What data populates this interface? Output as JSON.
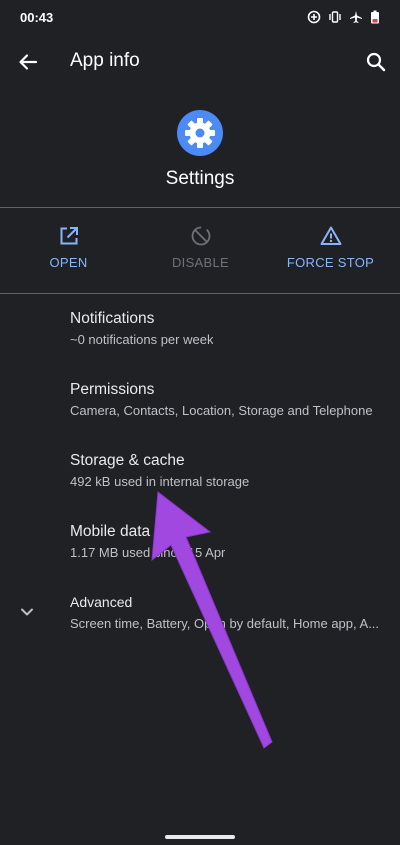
{
  "status_bar": {
    "time": "00:43",
    "icons": [
      "data-saver-icon",
      "vibrate-icon",
      "airplane-icon",
      "battery-low-icon"
    ]
  },
  "app_bar": {
    "title": "App info",
    "back_icon": "arrow-back-icon",
    "search_icon": "search-icon"
  },
  "app": {
    "name": "Settings",
    "icon": "gear-icon",
    "icon_color": "#4c8bf5"
  },
  "actions": [
    {
      "label": "OPEN",
      "icon": "open-external-icon",
      "enabled": true
    },
    {
      "label": "DISABLE",
      "icon": "disable-icon",
      "enabled": false
    },
    {
      "label": "FORCE STOP",
      "icon": "warning-icon",
      "enabled": true
    }
  ],
  "list": [
    {
      "title": "Notifications",
      "subtitle": "~0 notifications per week"
    },
    {
      "title": "Permissions",
      "subtitle": "Camera, Contacts, Location, Storage and Telephone"
    },
    {
      "title": "Storage & cache",
      "subtitle": "492 kB used in internal storage"
    },
    {
      "title": "Mobile data",
      "subtitle": "1.17 MB used since 15 Apr"
    },
    {
      "title": "Advanced",
      "subtitle": "Screen time, Battery, Open by default, Home app, A...",
      "icon": "chevron-down-icon"
    }
  ],
  "colors": {
    "background": "#202125",
    "accent": "#8ab4f8",
    "annotation_arrow": "#a148e0"
  }
}
